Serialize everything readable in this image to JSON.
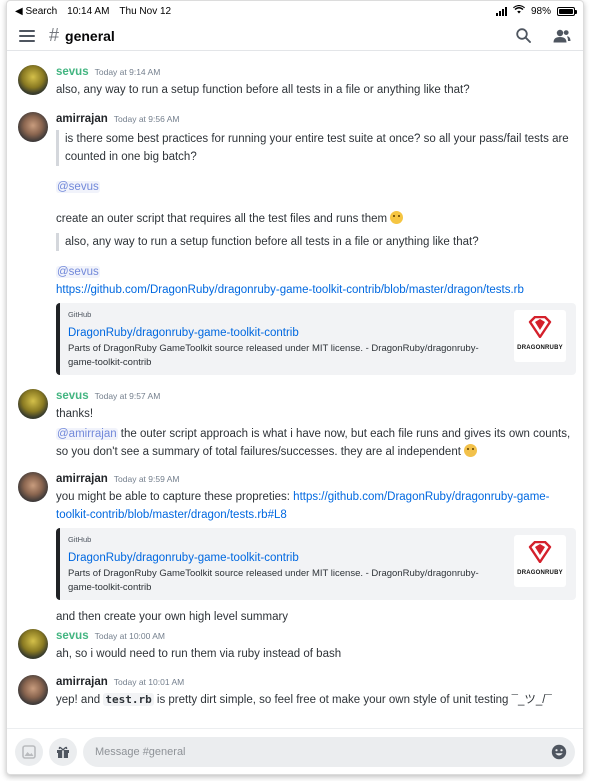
{
  "status": {
    "back_label": "◀ Search",
    "time": "10:14 AM",
    "date": "Thu Nov 12",
    "battery": "98%",
    "battery_level": 0.98
  },
  "header": {
    "menu_icon": "hamburger-icon",
    "hash": "#",
    "channel": "general",
    "search_icon": "search-icon",
    "members_icon": "members-icon"
  },
  "messages": [
    {
      "author": "sevus",
      "time": "Today at 9:14 AM",
      "text": "also, any way to run a setup function before all tests in a file or anything like that?"
    },
    {
      "author": "amirrajan",
      "time": "Today at 9:56 AM",
      "quote1": "is there some best practices for running your entire test suite at once?  so all your pass/fail tests are counted in one big batch?",
      "mention1": "@sevus",
      "text1": "create an outer script that requires all the test files and runs them",
      "quote2": "also, any way to run a setup function before all tests in a file or anything like that?",
      "mention2": "@sevus",
      "link": "https://github.com/DragonRuby/dragonruby-game-toolkit-contrib/blob/master/dragon/tests.rb",
      "embed": {
        "provider": "GitHub",
        "title": "DragonRuby/dragonruby-game-toolkit-contrib",
        "description": "Parts of DragonRuby GameToolkit source released under MIT license. - DragonRuby/dragonruby-game-toolkit-contrib",
        "brand": "DRAGONRUBY"
      }
    },
    {
      "author": "sevus",
      "time": "Today at 9:57 AM",
      "text1": "thanks!",
      "mention": "@amirrajan",
      "text2": " the outer script approach is what i have now, but each file runs and gives its own counts, so you don't see a summary of total failures/successes.  they are al independent"
    },
    {
      "author": "amirrajan",
      "time": "Today at 9:59 AM",
      "text1": "you might be able to capture these propreties: ",
      "link": "https://github.com/DragonRuby/dragonruby-game-toolkit-contrib/blob/master/dragon/tests.rb#L8",
      "embed": {
        "provider": "GitHub",
        "title": "DragonRuby/dragonruby-game-toolkit-contrib",
        "description": "Parts of DragonRuby GameToolkit source released under MIT license. - DragonRuby/dragonruby-game-toolkit-contrib",
        "brand": "DRAGONRUBY"
      },
      "text2": "and then create your own high level summary"
    },
    {
      "author": "sevus",
      "time": "Today at 10:00 AM",
      "text": "ah, so i would need to run them via ruby instead of bash"
    },
    {
      "author": "amirrajan",
      "time": "Today at 10:01 AM",
      "pre": "yep! and ",
      "code": "test.rb",
      "post": " is pretty dirt simple, so feel free ot make your own style of unit testing ¯_ツ_/¯"
    }
  ],
  "composer": {
    "placeholder": "Message #general",
    "image_icon": "image-icon",
    "gift_icon": "gift-icon",
    "emoji_icon": "emoji-icon"
  },
  "colors": {
    "author_sevus": "#43b581",
    "mention": "#7289da",
    "link": "#0068e0",
    "embed_border": "#202225",
    "dragonruby_red": "#d4202b"
  }
}
